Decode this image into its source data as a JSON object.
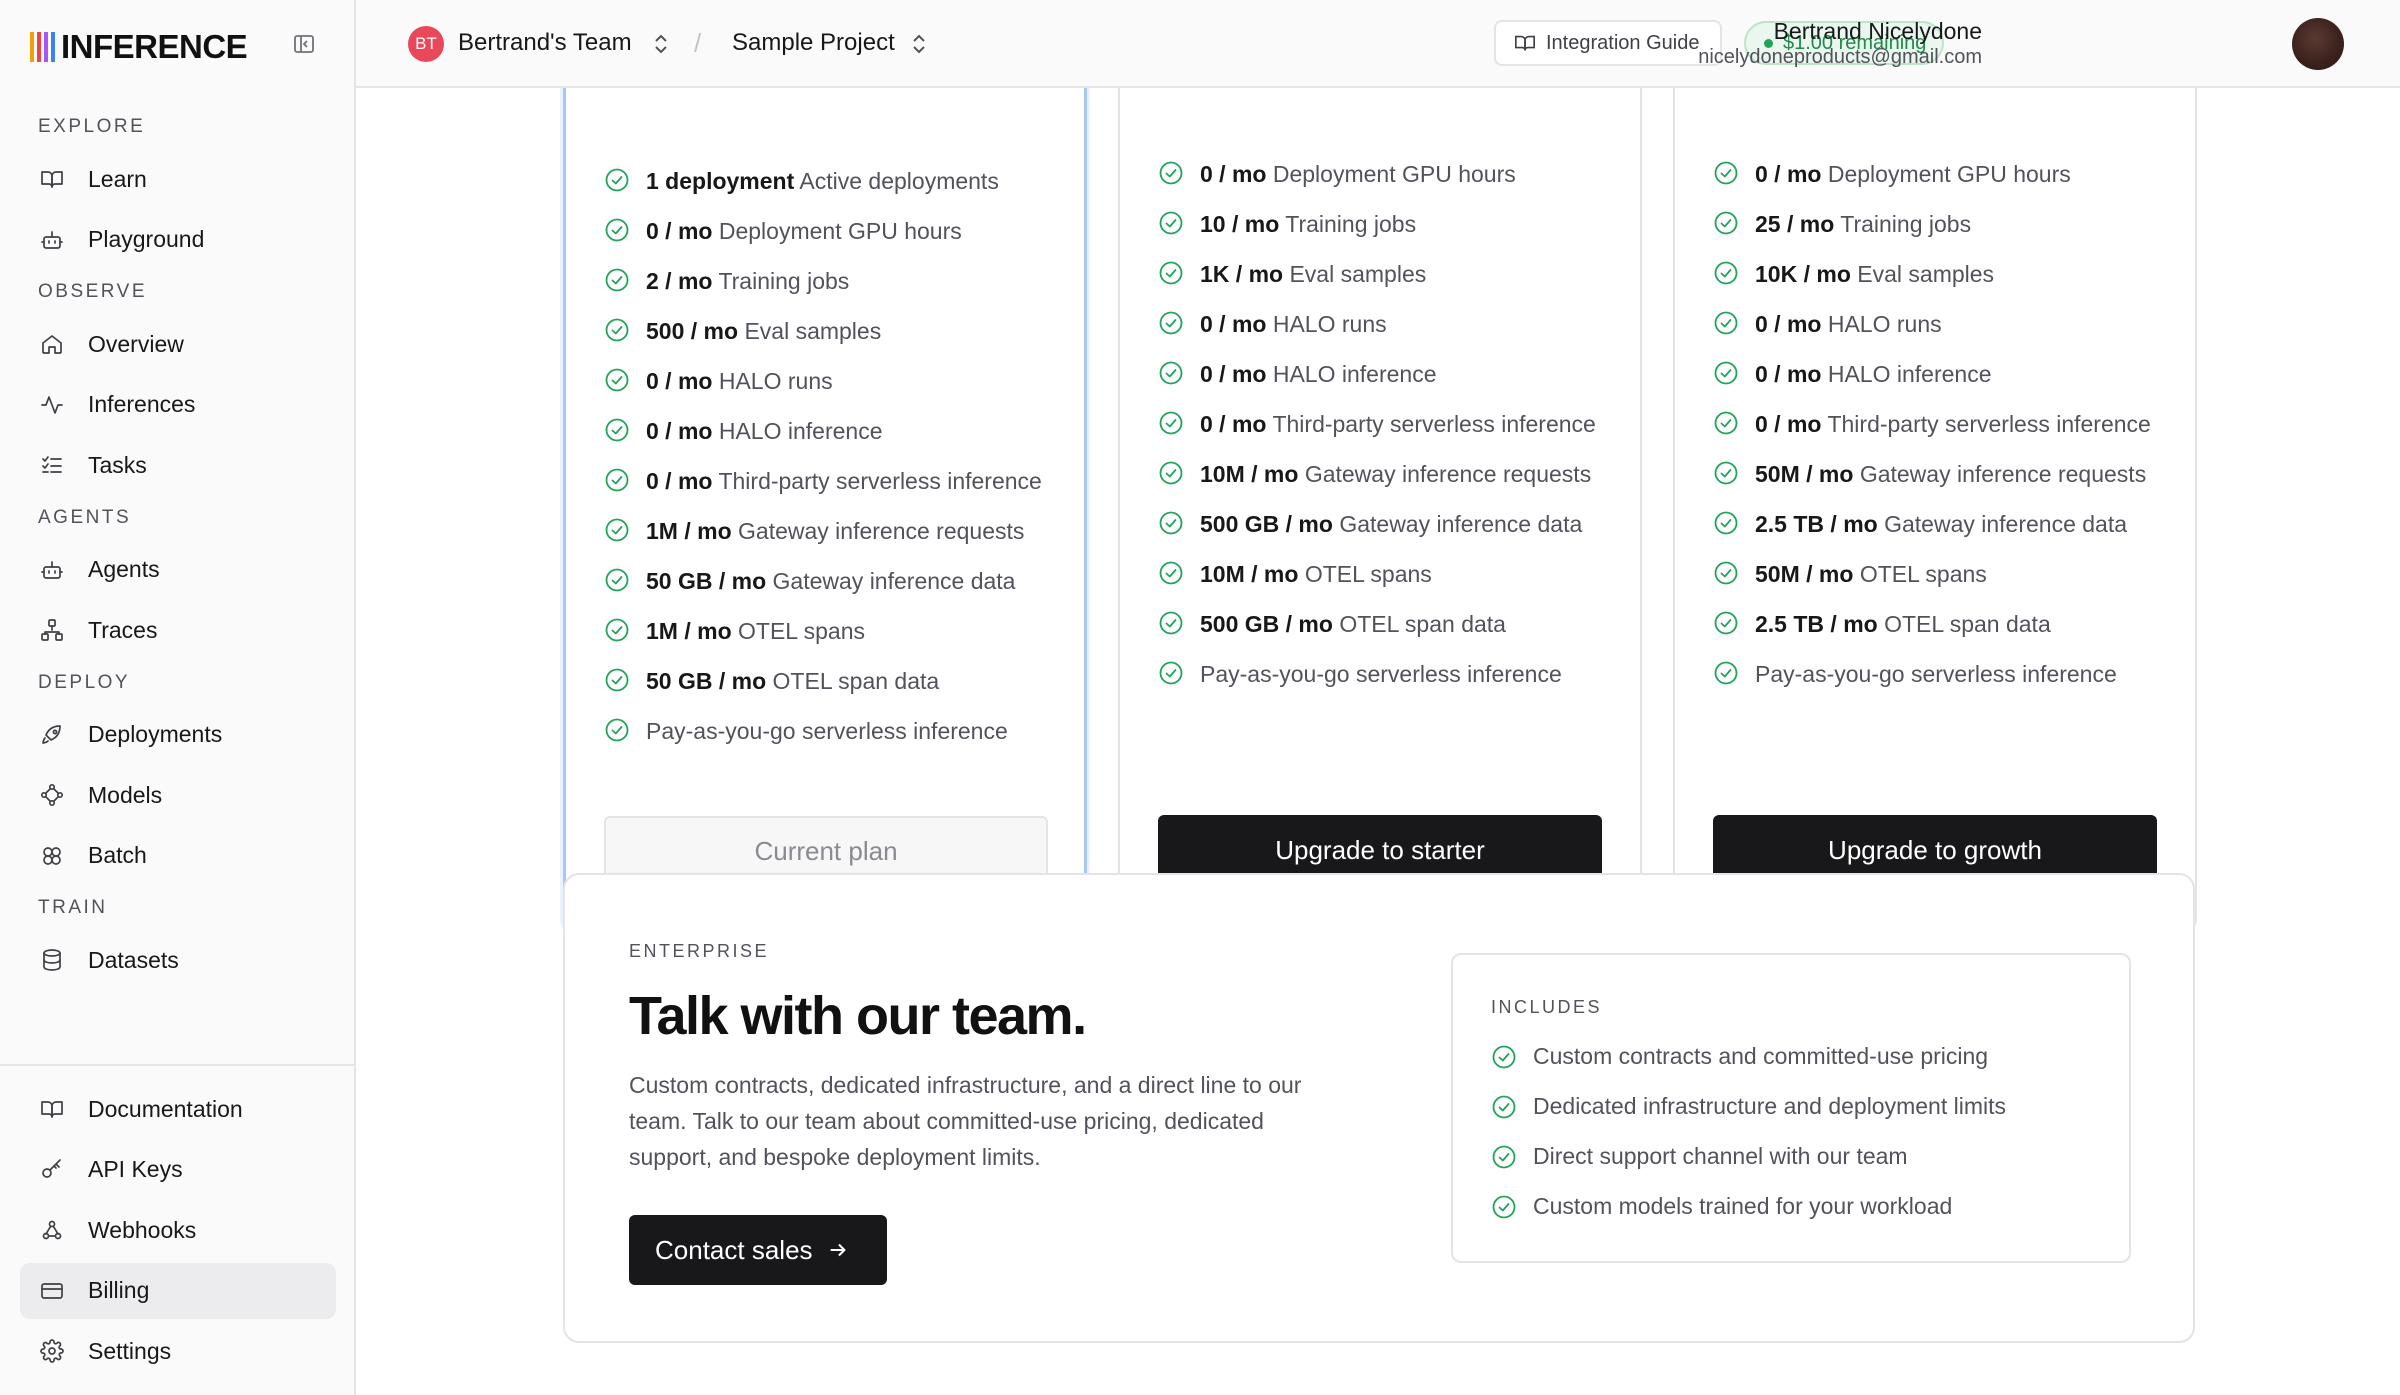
{
  "brand": {
    "logo_text": "INFERENCE",
    "bar_colors": [
      "#f59e0b",
      "#ef4444",
      "#a855f7",
      "#3b82f6"
    ]
  },
  "sidebar": {
    "sections": [
      {
        "label": "EXPLORE",
        "items": [
          {
            "label": "Learn",
            "icon": "book-icon"
          },
          {
            "label": "Playground",
            "icon": "robot-icon"
          }
        ]
      },
      {
        "label": "OBSERVE",
        "items": [
          {
            "label": "Overview",
            "icon": "home-icon"
          },
          {
            "label": "Inferences",
            "icon": "activity-icon"
          },
          {
            "label": "Tasks",
            "icon": "checklist-icon"
          }
        ]
      },
      {
        "label": "AGENTS",
        "items": [
          {
            "label": "Agents",
            "icon": "robot-icon"
          },
          {
            "label": "Traces",
            "icon": "workflow-icon"
          }
        ]
      },
      {
        "label": "DEPLOY",
        "items": [
          {
            "label": "Deployments",
            "icon": "rocket-icon"
          },
          {
            "label": "Models",
            "icon": "models-icon"
          },
          {
            "label": "Batch",
            "icon": "batch-icon"
          }
        ]
      },
      {
        "label": "TRAIN",
        "items": [
          {
            "label": "Datasets",
            "icon": "database-icon"
          }
        ]
      }
    ],
    "footer_items": [
      {
        "label": "Documentation",
        "icon": "book-icon"
      },
      {
        "label": "API Keys",
        "icon": "key-icon"
      },
      {
        "label": "Webhooks",
        "icon": "webhook-icon"
      },
      {
        "label": "Billing",
        "icon": "credit-card-icon",
        "active": true
      },
      {
        "label": "Settings",
        "icon": "gear-icon"
      }
    ]
  },
  "topbar": {
    "team_initials": "BT",
    "team_name": "Bertrand's Team",
    "separator": "/",
    "project_name": "Sample Project",
    "guide_label": "Integration Guide",
    "credit_label": "$1.00 remaining",
    "user_name": "Bertrand Nicelydone",
    "user_email": "nicelydoneproducts@gmail.com"
  },
  "plans": [
    {
      "button_label": "Current plan",
      "button_style": "muted",
      "features": [
        {
          "bold": "1 deployment",
          "text": "Active deployments"
        },
        {
          "bold": "0 / mo",
          "text": "Deployment GPU hours"
        },
        {
          "bold": "2 / mo",
          "text": "Training jobs"
        },
        {
          "bold": "500 / mo",
          "text": "Eval samples"
        },
        {
          "bold": "0 / mo",
          "text": "HALO runs"
        },
        {
          "bold": "0 / mo",
          "text": "HALO inference"
        },
        {
          "bold": "0 / mo",
          "text": "Third-party serverless inference"
        },
        {
          "bold": "1M / mo",
          "text": "Gateway inference requests"
        },
        {
          "bold": "50 GB / mo",
          "text": "Gateway inference data"
        },
        {
          "bold": "1M / mo",
          "text": "OTEL spans"
        },
        {
          "bold": "50 GB / mo",
          "text": "OTEL span data"
        },
        {
          "bold": "",
          "text": "Pay-as-you-go serverless inference"
        }
      ]
    },
    {
      "button_label": "Upgrade to starter",
      "button_style": "dark",
      "features": [
        {
          "bold": "0 / mo",
          "text": "Deployment GPU hours"
        },
        {
          "bold": "10 / mo",
          "text": "Training jobs"
        },
        {
          "bold": "1K / mo",
          "text": "Eval samples"
        },
        {
          "bold": "0 / mo",
          "text": "HALO runs"
        },
        {
          "bold": "0 / mo",
          "text": "HALO inference"
        },
        {
          "bold": "0 / mo",
          "text": "Third-party serverless inference"
        },
        {
          "bold": "10M / mo",
          "text": "Gateway inference requests"
        },
        {
          "bold": "500 GB / mo",
          "text": "Gateway inference data"
        },
        {
          "bold": "10M / mo",
          "text": "OTEL spans"
        },
        {
          "bold": "500 GB / mo",
          "text": "OTEL span data"
        },
        {
          "bold": "",
          "text": "Pay-as-you-go serverless inference"
        }
      ]
    },
    {
      "button_label": "Upgrade to growth",
      "button_style": "dark",
      "features": [
        {
          "bold": "0 / mo",
          "text": "Deployment GPU hours"
        },
        {
          "bold": "25 / mo",
          "text": "Training jobs"
        },
        {
          "bold": "10K / mo",
          "text": "Eval samples"
        },
        {
          "bold": "0 / mo",
          "text": "HALO runs"
        },
        {
          "bold": "0 / mo",
          "text": "HALO inference"
        },
        {
          "bold": "0 / mo",
          "text": "Third-party serverless inference"
        },
        {
          "bold": "50M / mo",
          "text": "Gateway inference requests"
        },
        {
          "bold": "2.5 TB / mo",
          "text": "Gateway inference data"
        },
        {
          "bold": "50M / mo",
          "text": "OTEL spans"
        },
        {
          "bold": "2.5 TB / mo",
          "text": "OTEL span data"
        },
        {
          "bold": "",
          "text": "Pay-as-you-go serverless inference"
        }
      ]
    }
  ],
  "enterprise": {
    "tag": "ENTERPRISE",
    "title": "Talk with our team.",
    "description": "Custom contracts, dedicated infrastructure, and a direct line to our team. Talk to our team about committed-use pricing, dedicated support, and bespoke deployment limits.",
    "button_label": "Contact sales",
    "includes_label": "INCLUDES",
    "includes": [
      "Custom contracts and committed-use pricing",
      "Dedicated infrastructure and deployment limits",
      "Direct support channel with our team",
      "Custom models trained for your workload"
    ]
  },
  "colors": {
    "check_green": "#22a35a",
    "current_plan_border": "#a7c8f2",
    "dark_button": "#18181b"
  }
}
